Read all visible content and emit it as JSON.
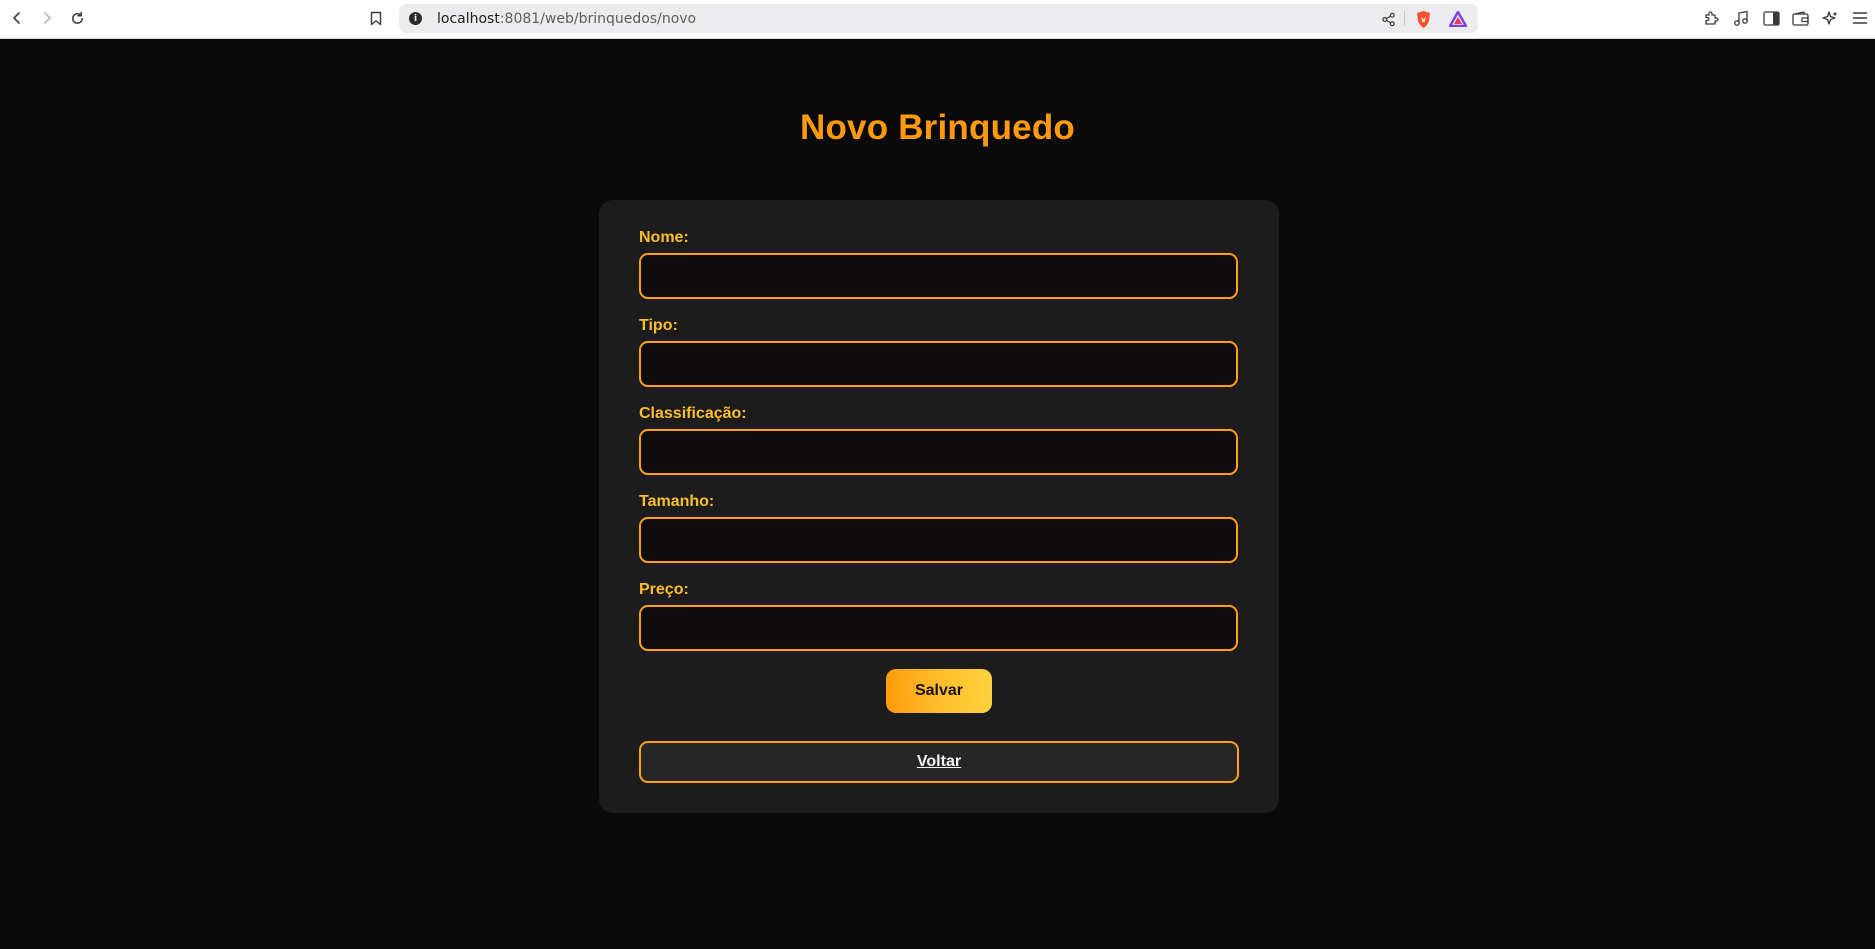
{
  "browser": {
    "url_host": "localhost",
    "url_path": ":8081/web/brinquedos/novo",
    "colors": {
      "brave_orange": "#fb542b",
      "chrome_bg": "#ffffff"
    },
    "icons": [
      "back-arrow-icon",
      "forward-arrow-icon",
      "reload-icon",
      "bookmark-icon",
      "site-info-icon",
      "share-icon",
      "brave-shields-icon",
      "brave-rewards-icon",
      "extensions-icon",
      "media-icon",
      "sidebar-icon",
      "wallet-icon",
      "leo-ai-icon",
      "menu-icon"
    ]
  },
  "page": {
    "title": "Novo Brinquedo",
    "colors": {
      "accent": "#ff9a0f",
      "label": "#fdbe2b",
      "background": "#0b0a0a",
      "card": "#1c1c1c"
    }
  },
  "form": {
    "fields": [
      {
        "label": "Nome:",
        "value": ""
      },
      {
        "label": "Tipo:",
        "value": ""
      },
      {
        "label": "Classificação:",
        "value": ""
      },
      {
        "label": "Tamanho:",
        "value": ""
      },
      {
        "label": "Preço:",
        "value": ""
      }
    ],
    "save_label": "Salvar",
    "back_label": "Voltar"
  }
}
